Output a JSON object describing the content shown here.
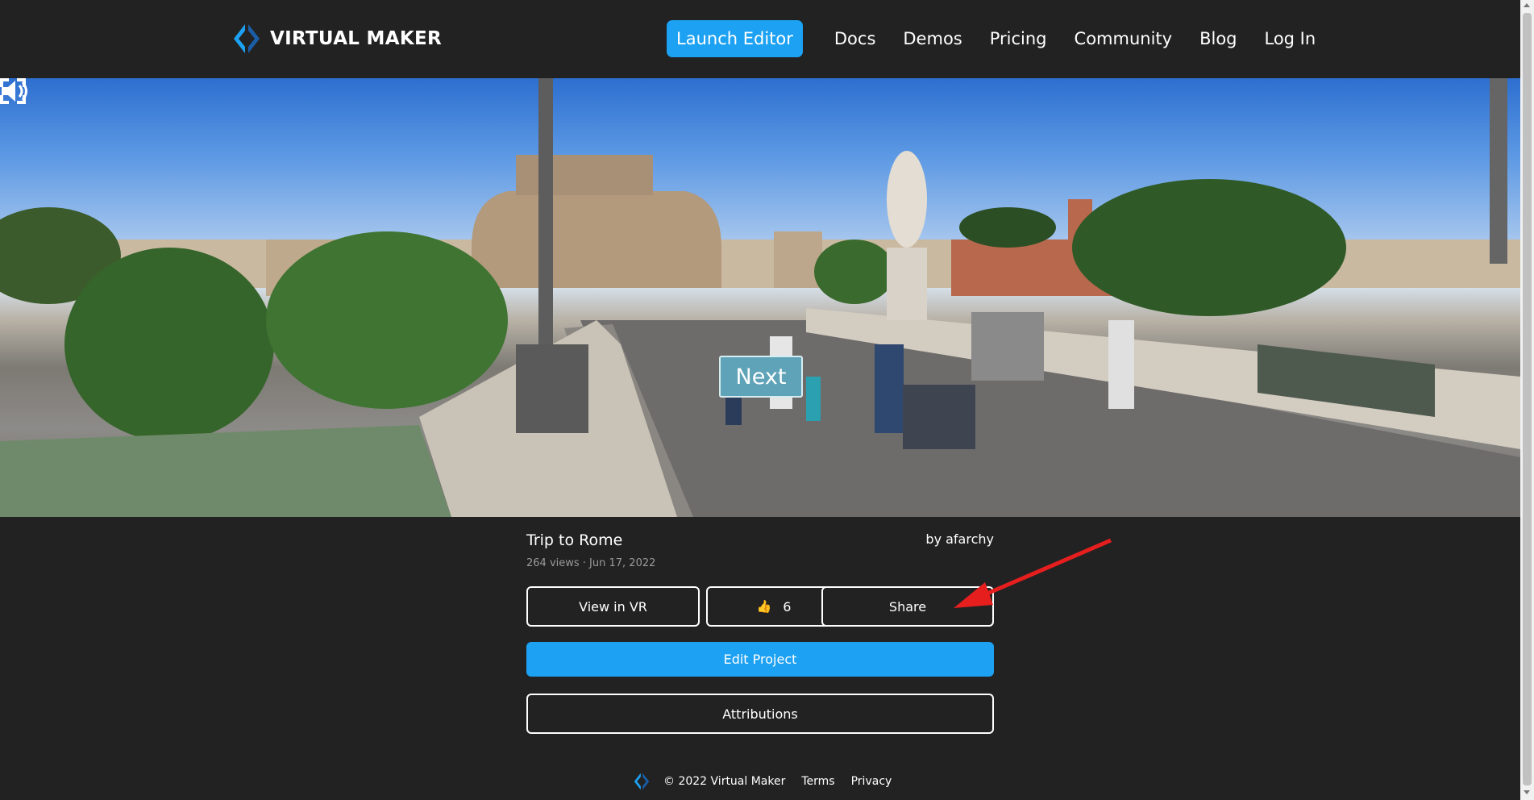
{
  "nav": {
    "brand": "VIRTUAL MAKER",
    "launch_label": "Launch Editor",
    "links": [
      "Docs",
      "Demos",
      "Pricing",
      "Community",
      "Blog",
      "Log In"
    ]
  },
  "hero": {
    "next_label": "Next",
    "icons": [
      "volume-icon",
      "fullscreen-icon"
    ]
  },
  "project": {
    "title": "Trip to Rome",
    "author": "by afarchy",
    "meta": "264 views · Jun 17, 2022",
    "view_vr_label": "View in VR",
    "like_icon": "👍",
    "like_count": "6",
    "share_label": "Share",
    "edit_label": "Edit Project",
    "attributions_label": "Attributions"
  },
  "footer": {
    "copyright": "© 2022 Virtual Maker",
    "terms": "Terms",
    "privacy": "Privacy"
  },
  "colors": {
    "background": "#222222",
    "accent": "#1da1f2",
    "annotation_arrow": "#e61e1e"
  }
}
